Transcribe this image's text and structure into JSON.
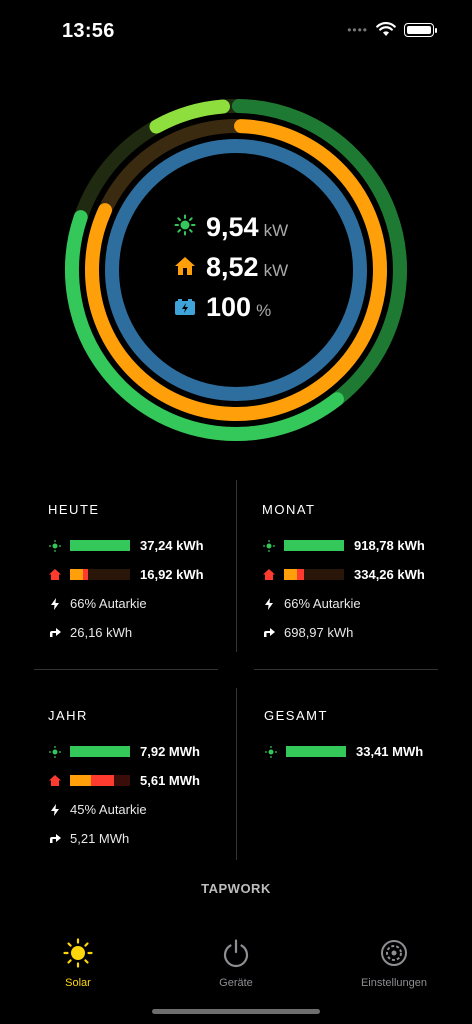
{
  "status_bar": {
    "time": "13:56"
  },
  "summary": {
    "solar": {
      "value": "9,54",
      "unit": "kW"
    },
    "house": {
      "value": "8,52",
      "unit": "kW"
    },
    "battery": {
      "value": "100",
      "unit": "%"
    }
  },
  "colors": {
    "green": "#34c759",
    "dark_green": "#1e7a33",
    "light_green": "#8ede3e",
    "orange": "#ff9f0a",
    "red": "#ff3b30",
    "blue": "#2e6e9e",
    "dark_brown": "#3a2a10"
  },
  "stats": {
    "heute": {
      "title": "HEUTE",
      "production": "37,24 kWh",
      "consumption": "16,92 kWh",
      "autarkie": "66% Autarkie",
      "export": "26,16 kWh"
    },
    "monat": {
      "title": "MONAT",
      "production": "918,78 kWh",
      "consumption": "334,26 kWh",
      "autarkie": "66% Autarkie",
      "export": "698,97 kWh"
    },
    "jahr": {
      "title": "JAHR",
      "production": "7,92 MWh",
      "consumption": "5,61 MWh",
      "autarkie": "45% Autarkie",
      "export": "5,21 MWh"
    },
    "gesamt": {
      "title": "GESAMT",
      "production": "33,41 MWh"
    }
  },
  "brand": "TAPWORK",
  "tabs": [
    {
      "label": "Solar",
      "icon": "sun-icon",
      "active": true
    },
    {
      "label": "Geräte",
      "icon": "power-icon",
      "active": false
    },
    {
      "label": "Einstellungen",
      "icon": "gear-icon",
      "active": false
    }
  ]
}
